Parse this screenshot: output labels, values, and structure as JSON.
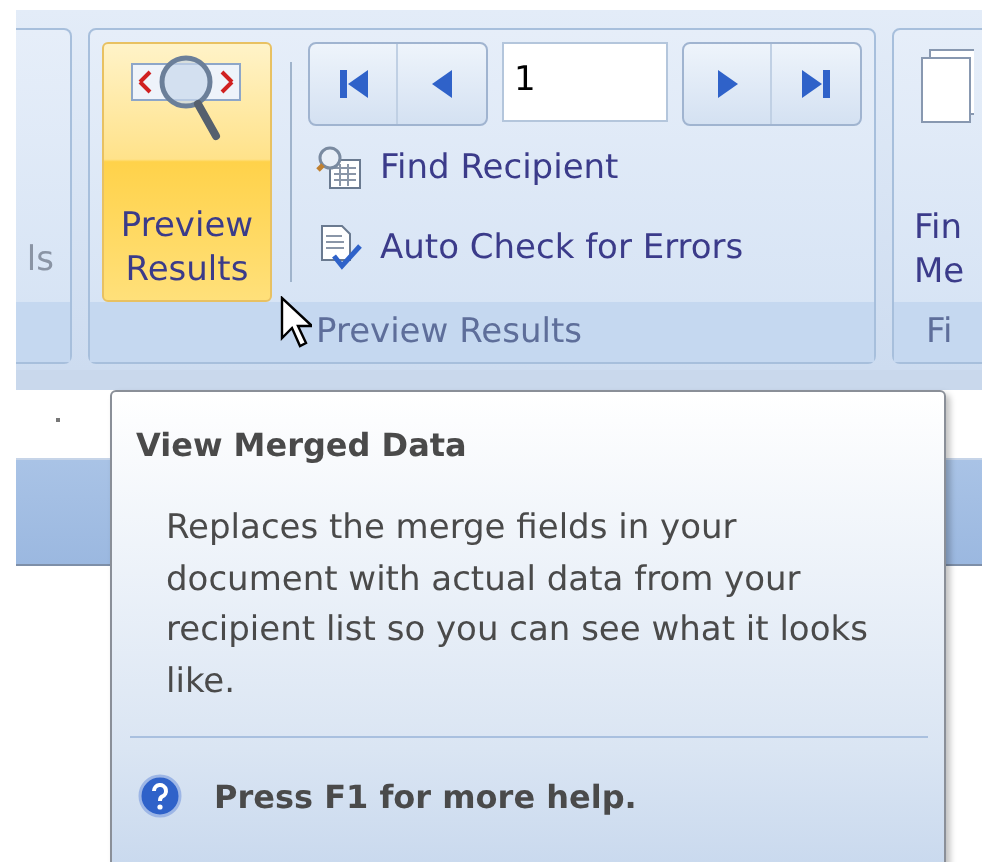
{
  "ribbon": {
    "left_group": {
      "label": "ls"
    },
    "group": {
      "label": "Preview Results",
      "big_button": {
        "label": "Preview Results",
        "hovered": true
      },
      "record_field": {
        "value": "1"
      },
      "commands": [
        {
          "label": "Find Recipient",
          "kind": "find"
        },
        {
          "label": "Auto Check for Errors",
          "kind": "check"
        }
      ]
    },
    "right_group": {
      "button_lines": [
        "Fin",
        "Me"
      ],
      "label": "Fi"
    }
  },
  "tooltip": {
    "title": "View Merged Data",
    "description": "Replaces the merge fields in your document with actual data from your recipient list so you can see what it looks like.",
    "help": "Press F1 for more help."
  }
}
